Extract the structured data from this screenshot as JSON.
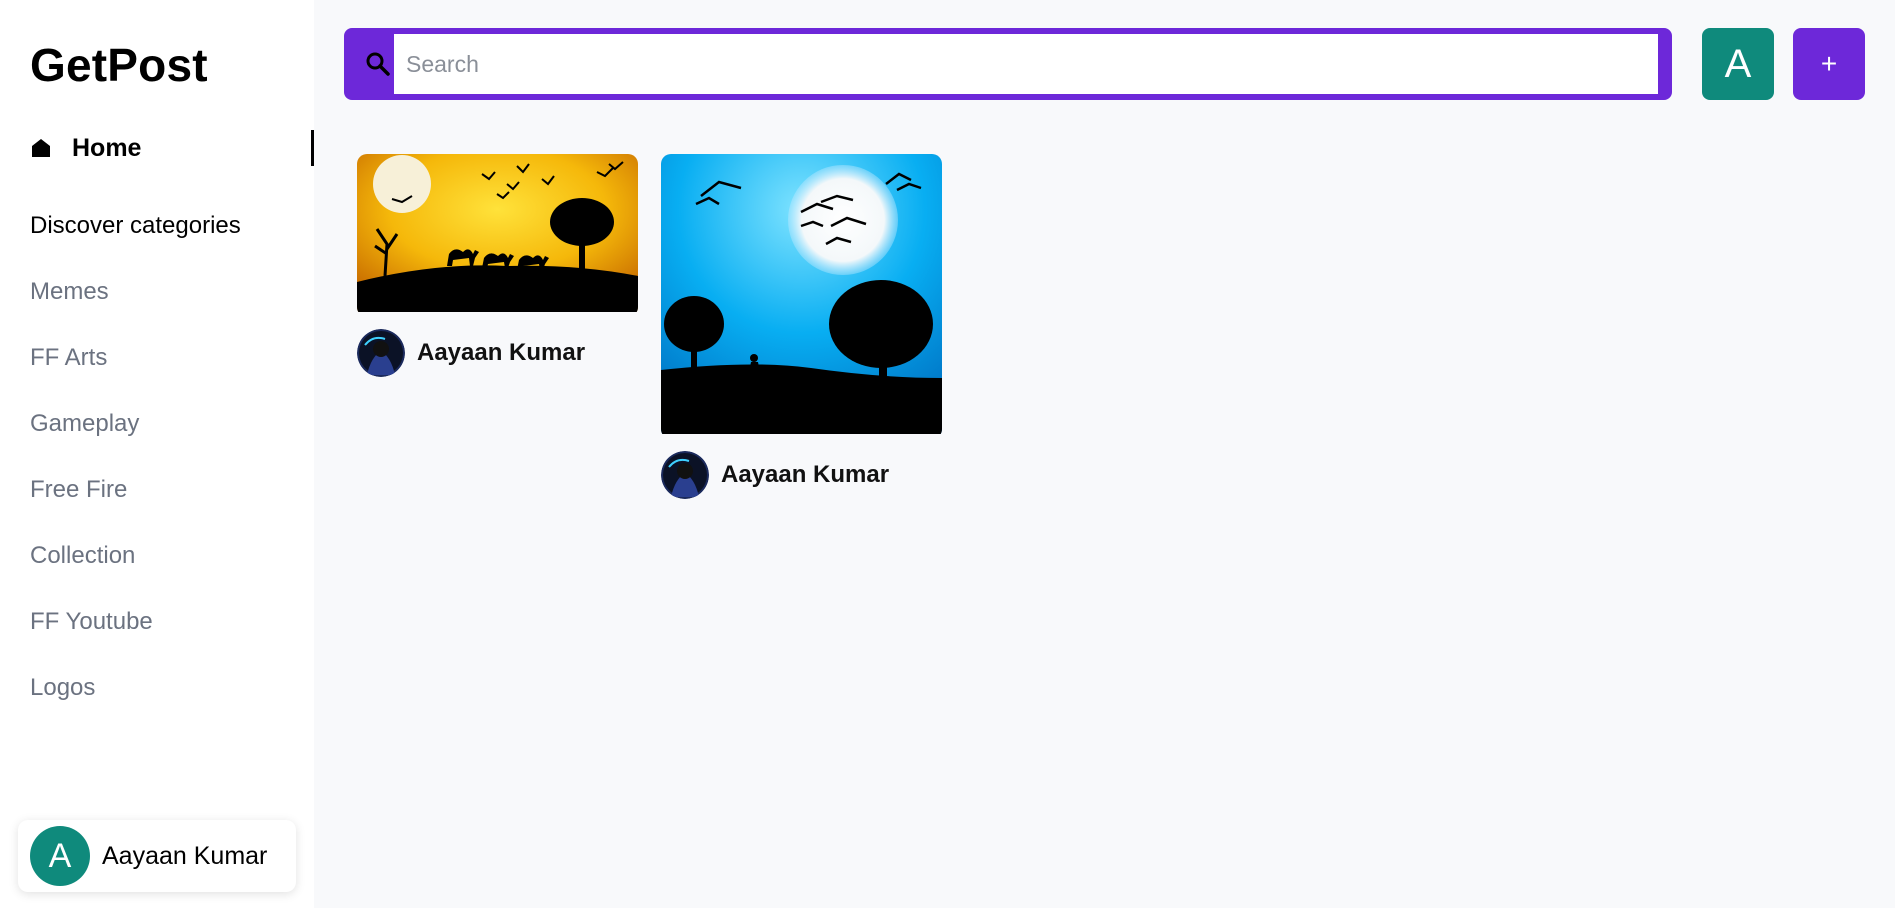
{
  "app": {
    "logo": "GetPost"
  },
  "sidebar": {
    "home_label": "Home",
    "discover_label": "Discover categories",
    "categories": [
      "Memes",
      "FF Arts",
      "Gameplay",
      "Free Fire",
      "Collection",
      "FF Youtube",
      "Logos"
    ],
    "user": {
      "initial": "A",
      "name": "Aayaan Kumar"
    }
  },
  "topbar": {
    "search_placeholder": "Search",
    "search_value": "",
    "profile_initial": "A",
    "add_label": "+"
  },
  "posts": [
    {
      "author": "Aayaan Kumar",
      "image": "sunset-desert-camels-silhouette"
    },
    {
      "author": "Aayaan Kumar",
      "image": "blue-moon-night-trees-silhouette"
    }
  ],
  "colors": {
    "accent": "#6d28d9",
    "avatar": "#0f8a7c",
    "muted_text": "#6b7280"
  }
}
